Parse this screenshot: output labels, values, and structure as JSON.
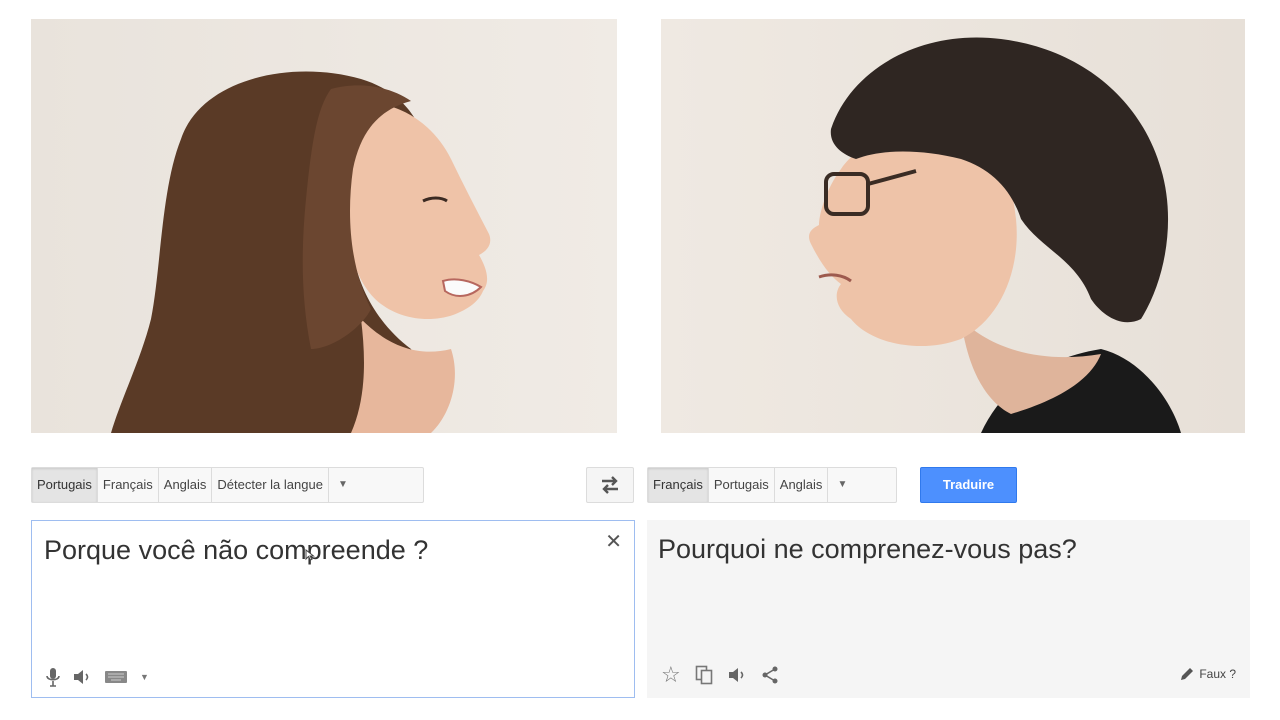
{
  "source": {
    "languages": [
      "Portugais",
      "Français",
      "Anglais",
      "Détecter la langue"
    ],
    "selected_index": 0,
    "text": "Porque você não compreende ?",
    "clear_icon": "close-icon",
    "tools": [
      "microphone-icon",
      "speaker-icon",
      "keyboard-icon",
      "chevron-down-icon"
    ]
  },
  "swap": {
    "icon": "swap-languages-icon"
  },
  "target": {
    "languages": [
      "Français",
      "Portugais",
      "Anglais"
    ],
    "selected_index": 0,
    "translate_label": "Traduire",
    "text": "Pourquoi ne comprenez-vous pas?",
    "tools": [
      "star-icon",
      "copy-icon",
      "speaker-icon",
      "share-icon"
    ],
    "wrong_label": "Faux ?"
  },
  "colors": {
    "accent": "#4d90fe",
    "source_border": "#9ebdf0",
    "target_bg": "#f5f5f5",
    "photo_bg": "#ece6df"
  }
}
